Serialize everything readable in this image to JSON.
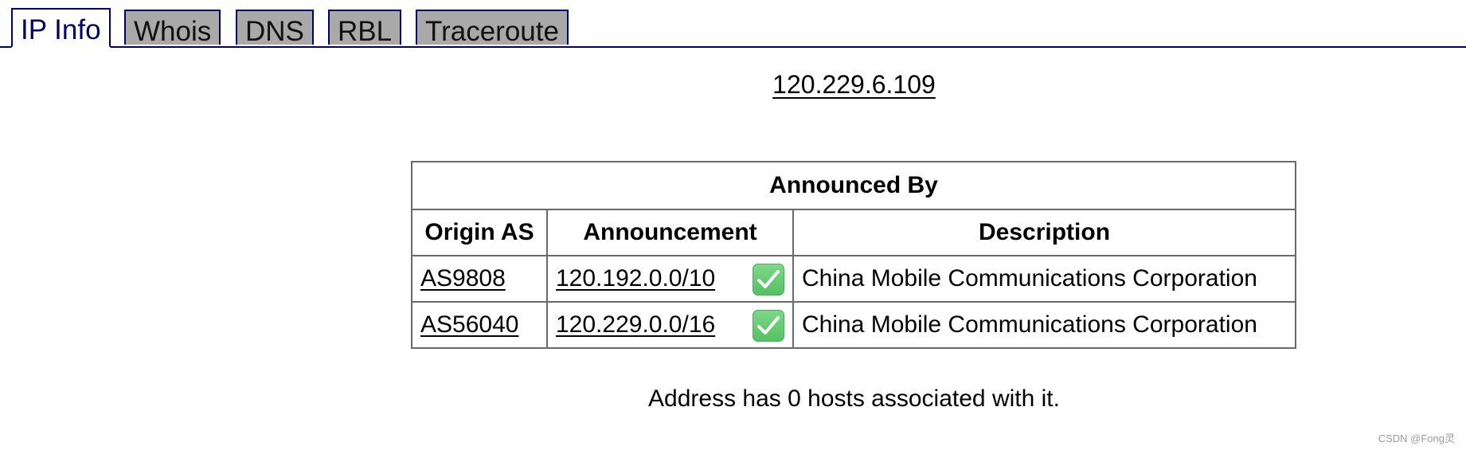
{
  "tabs": [
    {
      "label": "IP Info",
      "active": true
    },
    {
      "label": "Whois",
      "active": false
    },
    {
      "label": "DNS",
      "active": false
    },
    {
      "label": "RBL",
      "active": false
    },
    {
      "label": "Traceroute",
      "active": false
    }
  ],
  "ip_address": "120.229.6.109",
  "table": {
    "caption": "Announced By",
    "headers": [
      "Origin AS",
      "Announcement",
      "Description"
    ],
    "rows": [
      {
        "origin_as": "AS9808",
        "announcement": "120.192.0.0/10",
        "valid_icon": "green-check-icon",
        "description": "China Mobile Communications Corporation"
      },
      {
        "origin_as": "AS56040",
        "announcement": "120.229.0.0/16",
        "valid_icon": "green-check-icon",
        "description": "China Mobile Communications Corporation"
      }
    ]
  },
  "hosts_note": "Address has 0 hosts associated with it.",
  "watermark": "CSDN @Fong灵",
  "colors": {
    "tab_border": "#000066",
    "inactive_tab_bg": "#a9a9a9",
    "check_green": "#53c162"
  }
}
